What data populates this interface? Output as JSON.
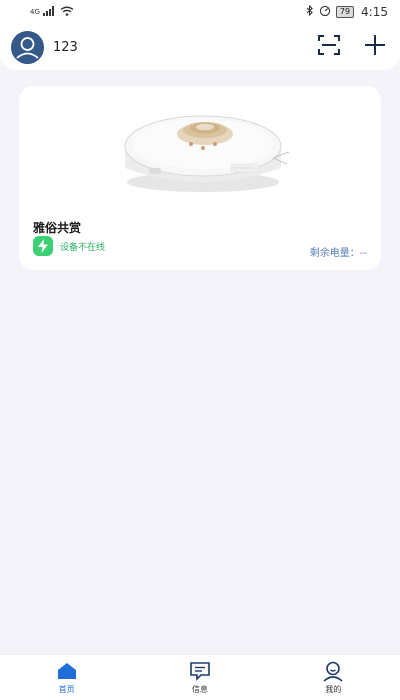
{
  "status_bar": {
    "network": "4G",
    "battery": "79",
    "time": "4:15"
  },
  "header": {
    "username": "123",
    "icons": [
      "user-avatar-icon",
      "scan-icon",
      "plus-icon"
    ]
  },
  "device": {
    "name": "雅俗共赏",
    "status": "设备不在线",
    "battery_label": "剩余电量：",
    "battery_value": "--",
    "image": "robot-vacuum"
  },
  "bottom_nav": {
    "items": [
      {
        "label": "首页",
        "icon": "home-icon",
        "active": true
      },
      {
        "label": "信息",
        "icon": "message-icon",
        "active": false
      },
      {
        "label": "我的",
        "icon": "profile-icon",
        "active": false
      }
    ]
  },
  "colors": {
    "accent": "#1e6fd9",
    "online_status": "#3ccf74",
    "background": "#f3f3f9"
  }
}
